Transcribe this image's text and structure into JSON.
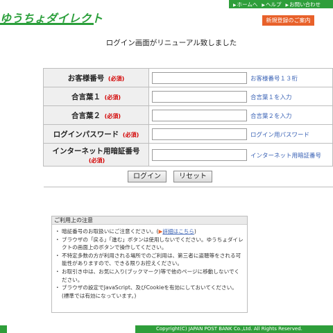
{
  "header": {
    "logo": "ゆうちょダイレクト",
    "links": [
      "ホームへ",
      "ヘルプ",
      "お問い合わせ"
    ],
    "register_button": "新規登録のご案内"
  },
  "page_title": "ログイン画面がリニューアル致しました",
  "form": {
    "required_mark": "(必須)",
    "rows": [
      {
        "label": "お客様番号",
        "hint": "お客様番号１３桁"
      },
      {
        "label": "合言葉１",
        "hint": "合言葉１を入力"
      },
      {
        "label": "合言葉２",
        "hint": "合言葉２を入力"
      },
      {
        "label": "ログインパスワード",
        "hint": "ログイン用パスワード"
      },
      {
        "label": "インターネット用暗証番号",
        "hint": "インターネット用暗証番号"
      }
    ],
    "login_button": "ログイン",
    "reset_button": "リセット"
  },
  "notice": {
    "title": "ご利用上の注意",
    "items": [
      {
        "text": "暗証番号のお取扱いにご注意ください。(",
        "link": "詳細はこちら",
        "after": ")"
      },
      {
        "text": "ブラウザの「戻る」「進む」ボタンは使用しないでください。ゆうちょダイレクトの画面上のボタンで操作してください。"
      },
      {
        "text": "不特定多数の方が利用される場所でのご利用は、第三者に盗聴等をされる可能性がありますので、できる限りお控えください。"
      },
      {
        "text": "お取引き中は、お気に入り(ブックマーク)等で他のページに移動しないでください。"
      },
      {
        "text": "ブラウザの設定でJavaScript、及びCookieを有効にしておいてください。(標準では有効になっています。)"
      }
    ]
  },
  "footer": {
    "copyright": "Copyright(C) JAPAN POST BANK Co.,Ltd. All Rights Reserved."
  }
}
